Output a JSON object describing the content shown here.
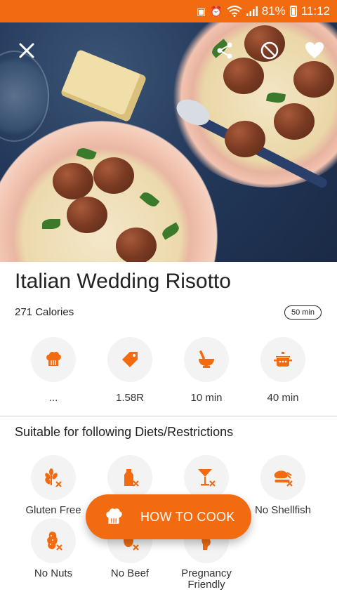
{
  "status_bar": {
    "battery": "81%",
    "time": "11:12",
    "icons": [
      "notification-icon",
      "alarm-icon",
      "wifi-icon",
      "signal-icon",
      "battery-icon"
    ]
  },
  "hero": {
    "icons": [
      "close-icon",
      "share-icon",
      "block-icon",
      "heart-icon"
    ]
  },
  "recipe": {
    "title": "Italian Wedding Risotto",
    "calories": "271 Calories",
    "total_time": "50 min"
  },
  "stats": [
    {
      "icon": "chef-hat-icon",
      "label": "..."
    },
    {
      "icon": "price-tag-icon",
      "label": "1.58R"
    },
    {
      "icon": "mortar-pestle-icon",
      "label": "10 min"
    },
    {
      "icon": "cooking-pot-icon",
      "label": "40 min"
    }
  ],
  "diets": {
    "heading": "Suitable for following Diets/Restrictions",
    "items": [
      {
        "icon": "gluten-free-icon",
        "label": "Gluten Free"
      },
      {
        "icon": "no-dairy-icon",
        "label": ""
      },
      {
        "icon": "no-alcohol-icon",
        "label": ""
      },
      {
        "icon": "no-shellfish-icon",
        "label": "No Shellfish"
      },
      {
        "icon": "no-nuts-icon",
        "label": "No Nuts"
      },
      {
        "icon": "no-beef-icon",
        "label": "No Beef"
      },
      {
        "icon": "pregnancy-icon",
        "label": "Pregnancy Friendly"
      }
    ]
  },
  "fab": {
    "label": "HOW TO COOK",
    "icon": "chef-hat-icon"
  },
  "colors": {
    "accent": "#f26b10",
    "circle_bg": "#f3f3f3",
    "text": "#222222"
  }
}
